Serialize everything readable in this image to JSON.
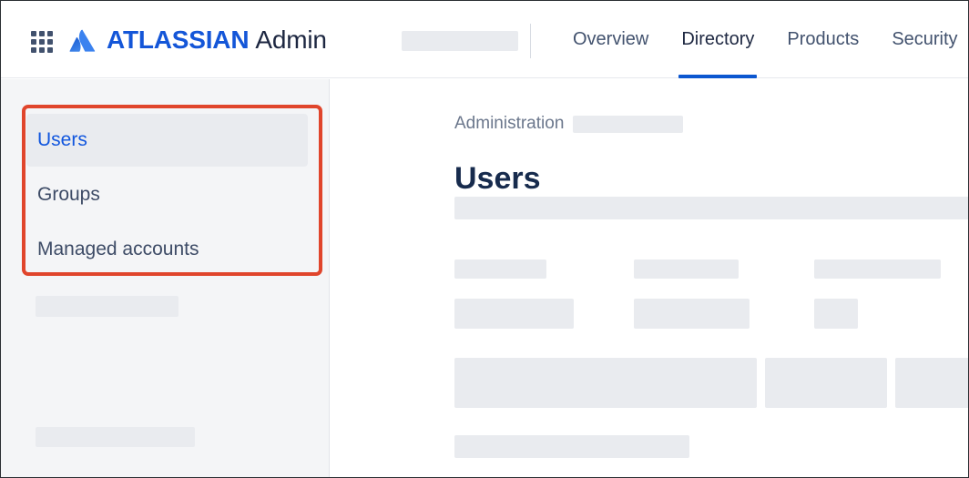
{
  "header": {
    "app_switcher_icon": "grid-apps-icon",
    "logo_icon": "atlassian-logo-icon",
    "brand_primary": "ATLASSIAN",
    "brand_secondary": "Admin",
    "redacted_site_name": "",
    "tabs": [
      {
        "label": "Overview",
        "active": false
      },
      {
        "label": "Directory",
        "active": true
      },
      {
        "label": "Products",
        "active": false
      },
      {
        "label": "Security",
        "active": false
      }
    ]
  },
  "sidebar": {
    "items": [
      {
        "label": "Users",
        "selected": true
      },
      {
        "label": "Groups",
        "selected": false
      },
      {
        "label": "Managed accounts",
        "selected": false
      }
    ],
    "skeletons": [
      "",
      ""
    ]
  },
  "main": {
    "breadcrumb": "Administration",
    "breadcrumb_redacted": "",
    "title": "Users",
    "skeletons": [
      "",
      "",
      "",
      "",
      "",
      "",
      "",
      "",
      "",
      "",
      ""
    ]
  },
  "colors": {
    "brand_blue": "#1456d8",
    "brand_navy": "#1d2741",
    "tab_active_underline": "#0c57d0",
    "highlight_red": "#e0452c",
    "selected_item_text": "#1156de",
    "selected_item_bg": "#e9ebef",
    "sidebar_bg": "#f4f5f7",
    "skeleton_gray": "#e9ebef",
    "breadcrumb_gray": "#6b778c",
    "title_navy": "#172b4d"
  }
}
